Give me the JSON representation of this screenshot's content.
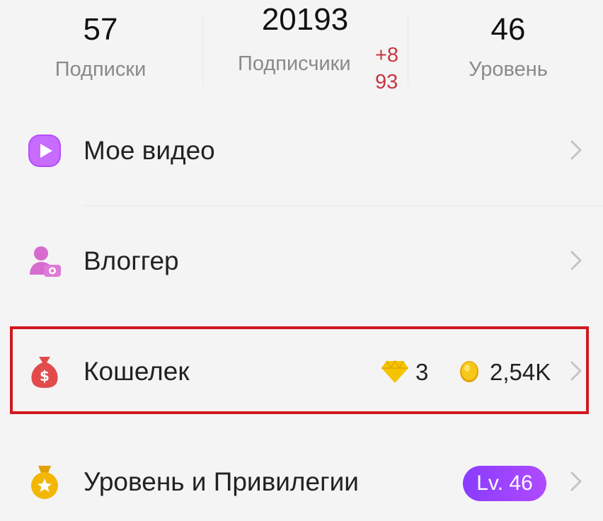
{
  "stats": {
    "subscriptions": {
      "value": "57",
      "label": "Подписки"
    },
    "followers": {
      "value": "20193",
      "label": "Подписчики",
      "plus_line1": "+8",
      "plus_line2": "93"
    },
    "level": {
      "value": "46",
      "label": "Уровень"
    }
  },
  "menu": {
    "my_video": {
      "label": "Мое видео",
      "icon": "play-icon"
    },
    "vlogger": {
      "label": "Влоггер",
      "icon": "person-camera-icon"
    },
    "wallet": {
      "label": "Кошелек",
      "icon": "money-bag-icon",
      "diamonds": "3",
      "coins": "2,54K"
    },
    "level_privileges": {
      "label": "Уровень и Привилегии",
      "icon": "medal-icon",
      "badge": "Lv. 46"
    }
  },
  "colors": {
    "accent_purple": "#a855f7",
    "highlight_red": "#d2181f",
    "plus_red": "#c9363f",
    "gold": "#f0b400"
  }
}
